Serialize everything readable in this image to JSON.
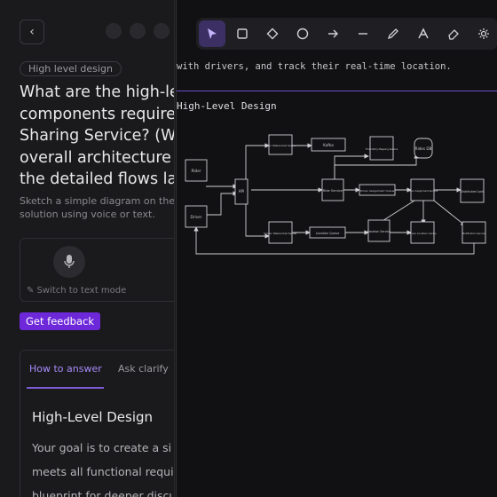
{
  "left": {
    "back_icon": "chevron-left-icon",
    "tag": "High level design",
    "question_lines": [
      "What are the high-le",
      "components required",
      "Sharing Service? (We",
      "overall architecture f",
      "the detailed flows lat"
    ],
    "sub_lines": [
      "Sketch a simple diagram on the",
      "solution using voice or text."
    ],
    "mic_icon": "microphone-icon",
    "switch_label": "Switch to text mode",
    "feedback_button": "Get feedback",
    "tabs": [
      "How to answer",
      "Ask clarify"
    ],
    "panel_heading": "High-Level Design",
    "panel_lines": [
      "Your goal is to create a si",
      "meets all functional requi",
      "blueprint for deeper discu"
    ]
  },
  "canvas": {
    "tools": [
      {
        "icon": "pointer-icon"
      },
      {
        "icon": "rectangle-icon"
      },
      {
        "icon": "diamond-icon"
      },
      {
        "icon": "circle-icon"
      },
      {
        "icon": "arrow-icon"
      },
      {
        "icon": "line-icon"
      },
      {
        "icon": "pencil-icon"
      },
      {
        "icon": "text-icon"
      },
      {
        "icon": "eraser-icon"
      },
      {
        "icon": "settings-icon"
      }
    ],
    "snippet_text": "with drivers, and track their real-time location.",
    "diagram_title": "High-Level Design",
    "nodes": {
      "rider": "Rider",
      "driver": "Driver",
      "api": "API",
      "rider_ws": "Rider Websocket Server",
      "kafka": "Kafka",
      "third_party": "Third Party Mapping Service",
      "rides_db": "Rides DB",
      "ride_service": "Ride Service",
      "driver_assign_queue": "Driver Assignment Queue",
      "driver_assign_service": "Driver Assignment Service",
      "dist_lock": "Distributed Lock",
      "driver_ws": "Driver Websocket Server",
      "location_queue": "Location Queue",
      "location_service": "Location Service",
      "driver_location_cache": "Driver Location Cache",
      "notification_service": "Notification Service"
    }
  }
}
